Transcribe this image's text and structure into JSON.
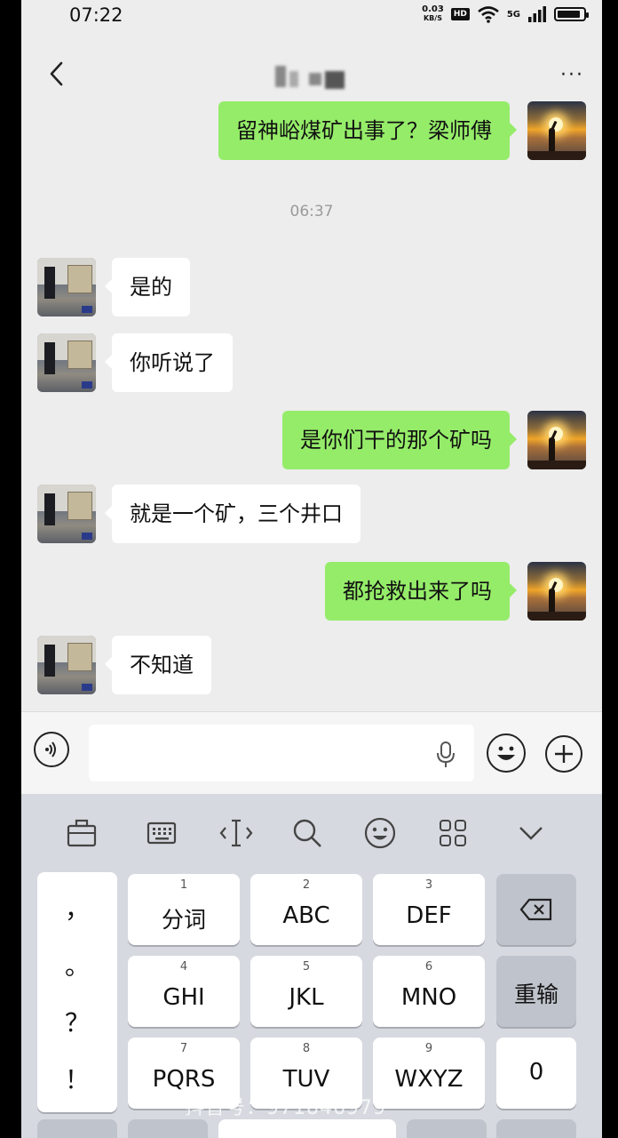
{
  "status_bar": {
    "time": "07:22",
    "net_speed_value": "0.03",
    "net_speed_unit": "KB/S",
    "hd_label": "HD",
    "network_label": "5G",
    "battery_level": 0.9
  },
  "chat": {
    "more_label": "···",
    "timestamp": "06:37",
    "messages": [
      {
        "sender": "self",
        "text": "留神峪煤矿出事了？梁师傅"
      },
      {
        "sender": "other",
        "text": "是的"
      },
      {
        "sender": "other",
        "text": "你听说了"
      },
      {
        "sender": "self",
        "text": "是你们干的那个矿吗"
      },
      {
        "sender": "other",
        "text": "就是一个矿，三个井口"
      },
      {
        "sender": "self",
        "text": "都抢救出来了吗"
      },
      {
        "sender": "other",
        "text": "不知道"
      }
    ]
  },
  "input": {
    "placeholder": ""
  },
  "keyboard": {
    "punctuation": [
      "，",
      "。",
      "？",
      "！"
    ],
    "keys": [
      {
        "num": "1",
        "label": "分词"
      },
      {
        "num": "2",
        "label": "ABC"
      },
      {
        "num": "3",
        "label": "DEF"
      },
      {
        "num": "4",
        "label": "GHI"
      },
      {
        "num": "5",
        "label": "JKL"
      },
      {
        "num": "6",
        "label": "MNO"
      },
      {
        "num": "7",
        "label": "PQRS"
      },
      {
        "num": "8",
        "label": "TUV"
      },
      {
        "num": "9",
        "label": "WXYZ"
      }
    ],
    "retype_label": "重输",
    "zero_label": "0"
  },
  "watermark": "抖音号：971846979"
}
